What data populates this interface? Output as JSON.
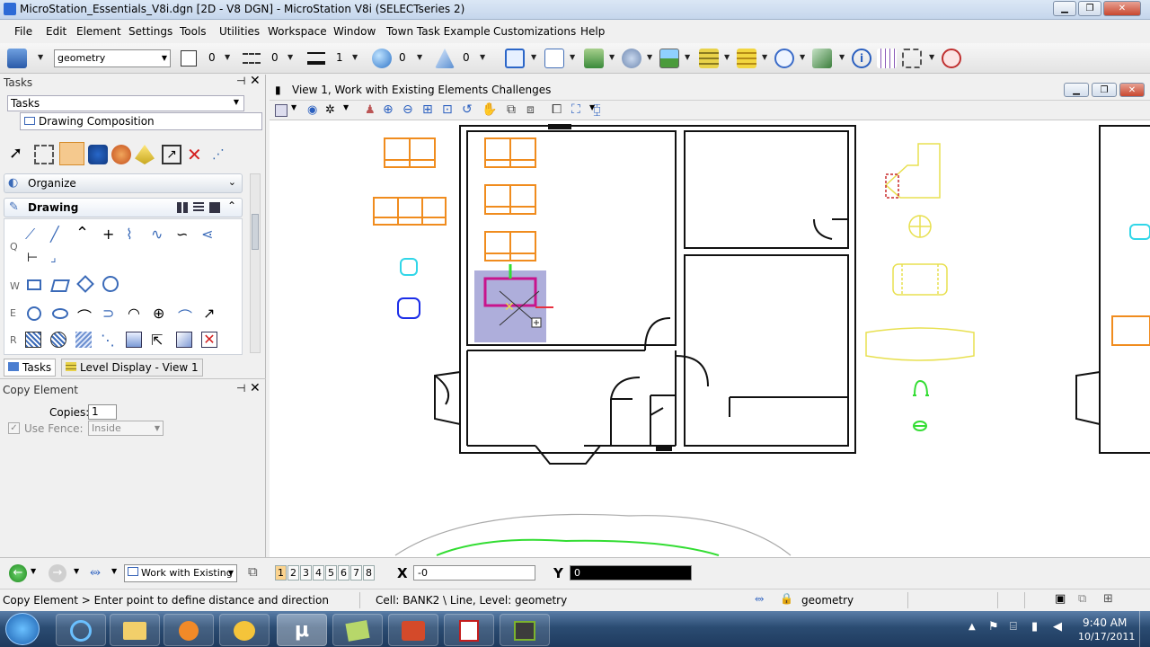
{
  "window": {
    "title": "MicroStation_Essentials_V8i.dgn [2D - V8 DGN] - MicroStation V8i (SELECTseries 2)"
  },
  "menu": [
    "File",
    "Edit",
    "Element",
    "Settings",
    "Tools",
    "Utilities",
    "Workspace",
    "Window",
    "Town Task Example",
    "Customizations",
    "Help"
  ],
  "toolbar": {
    "level": "geometry",
    "color": "0",
    "style": "0",
    "weight": "1",
    "transparency": "0",
    "priority": "0"
  },
  "tasks_panel": {
    "title": "Tasks",
    "dropdown": "Tasks",
    "subtitle": "Drawing Composition",
    "organize": "Organize",
    "drawing": "Drawing",
    "row_labels": [
      "Q",
      "W",
      "E",
      "R"
    ],
    "tabs": [
      "Tasks",
      "Level Display - View 1"
    ]
  },
  "tool_settings": {
    "title": "Copy Element",
    "copies_label": "Copies:",
    "copies_value": "1",
    "use_fence_label": "Use Fence:",
    "use_fence_value": "Inside"
  },
  "view": {
    "title": "View 1, Work with Existing Elements Challenges"
  },
  "statusbar": {
    "workflow": "Work with Existing",
    "view_numbers": [
      "1",
      "2",
      "3",
      "4",
      "5",
      "6",
      "7",
      "8"
    ],
    "x_label": "X",
    "x_value": "-0",
    "y_label": "Y",
    "y_value": "0",
    "prompt": "Copy Element > Enter point to define distance and direction",
    "info": "Cell: BANK2 \\ Line, Level: geometry",
    "active_level": "geometry"
  },
  "taskbar": {
    "time": "9:40 AM",
    "date": "10/17/2011"
  },
  "colors": {
    "cad_orange": "#f08c1e",
    "cad_cyan": "#31d6e8",
    "cad_blue": "#1c2ee8",
    "cad_yellow": "#e8e050",
    "cad_green": "#33dd33",
    "cad_magenta": "#c8148c",
    "selection": "#8c8ccc"
  }
}
